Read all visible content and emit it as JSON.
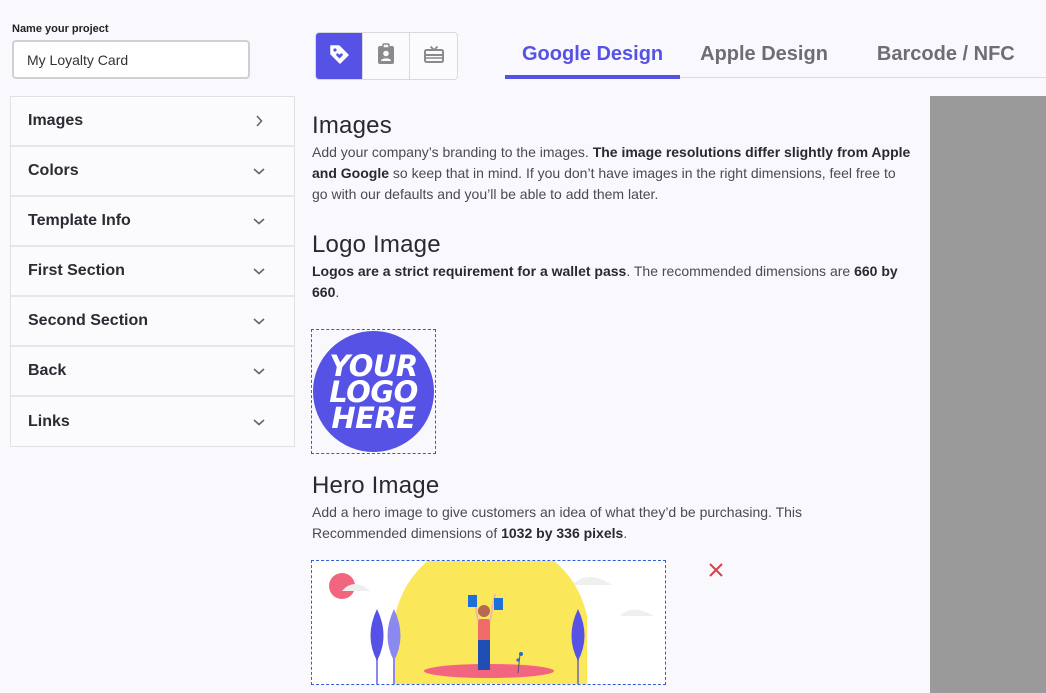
{
  "project": {
    "label": "Name your project",
    "value": "My Loyalty Card"
  },
  "sidebar": {
    "items": [
      {
        "label": "Images",
        "icon": "chevron-right-icon"
      },
      {
        "label": "Colors",
        "icon": "chevron-down-icon"
      },
      {
        "label": "Template Info",
        "icon": "chevron-down-icon"
      },
      {
        "label": "First Section",
        "icon": "chevron-down-icon"
      },
      {
        "label": "Second Section",
        "icon": "chevron-down-icon"
      },
      {
        "label": "Back",
        "icon": "chevron-down-icon"
      },
      {
        "label": "Links",
        "icon": "chevron-down-icon"
      }
    ]
  },
  "pass_types": [
    {
      "name": "loyalty-tag-icon",
      "active": true
    },
    {
      "name": "id-badge-icon",
      "active": false
    },
    {
      "name": "gift-card-icon",
      "active": false
    }
  ],
  "tabs": [
    {
      "label": "Google Design",
      "active": true
    },
    {
      "label": "Apple Design",
      "active": false
    },
    {
      "label": "Barcode / NFC",
      "active": false
    }
  ],
  "sections": {
    "images": {
      "title": "Images",
      "text1": "Add your company’s branding to the images. ",
      "bold1": "The image resolutions differ slightly from Apple and Google",
      "text2": " so keep that in mind. If you don’t have images in the right dimensions, feel free to go with our defaults and you’ll be able to add them later."
    },
    "logo": {
      "title": "Logo Image",
      "bold1": "Logos are a strict requirement for a wallet pass",
      "text1": ". The recommended dimensions are ",
      "bold2": "660 by 660",
      "text2": ".",
      "placeholder_lines": [
        "YOUR",
        "LOGO",
        "HERE"
      ]
    },
    "hero": {
      "title": "Hero Image",
      "text1": "Add a hero image to give customers an idea of what they’d be purchasing. This Recommended dimensions of ",
      "bold1": "1032 by 336 pixels",
      "text2": "."
    }
  },
  "colors": {
    "accent": "#5652e6",
    "remove": "#d9414a",
    "preview_bg": "#9a9a9a"
  }
}
